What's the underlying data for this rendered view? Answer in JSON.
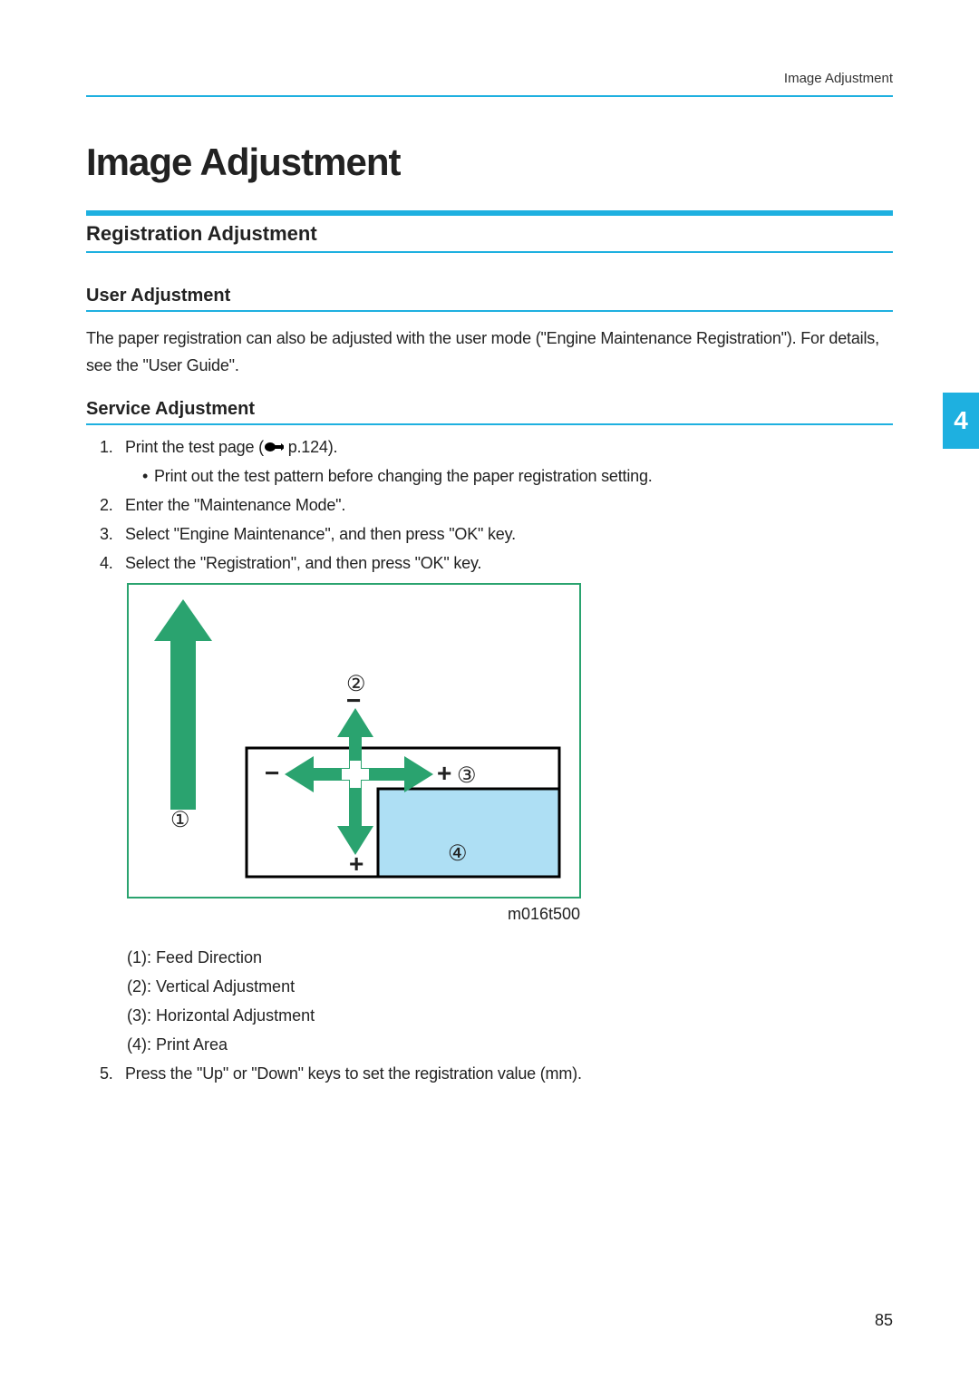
{
  "running_header": "Image Adjustment",
  "page_title": "Image Adjustment",
  "section_title": "Registration Adjustment",
  "subsection1_title": "User Adjustment",
  "subsection1_body": "The paper registration can also be adjusted with the user mode (\"Engine Maintenance Registration\"). For details, see the \"User Guide\".",
  "subsection2_title": "Service Adjustment",
  "steps": {
    "s1num": "1.",
    "s1a": "Print the test page (",
    "s1b": " p.124).",
    "s1_sub": "Print out the test pattern before changing the paper registration setting.",
    "s2num": "2.",
    "s2": "Enter the \"Maintenance Mode\".",
    "s3num": "3.",
    "s3": "Select \"Engine Maintenance\", and then press \"OK\" key.",
    "s4num": "4.",
    "s4": "Select the \"Registration\", and then press \"OK\" key.",
    "s5num": "5.",
    "s5": "Press the \"Up\" or \"Down\" keys to set the registration value (mm)."
  },
  "legend": {
    "l1": "(1): Feed Direction",
    "l2": "(2): Vertical Adjustment",
    "l3": "(3): Horizontal Adjustment",
    "l4": "(4): Print Area"
  },
  "diagram": {
    "code": "m016t500",
    "label1": "①",
    "label2": "②",
    "label3": "③",
    "label4": "④",
    "minus_top": "−",
    "plus_bottom": "+",
    "minus_left": "−",
    "plus_right": "+"
  },
  "chapter_tab": "4",
  "page_number": "85"
}
